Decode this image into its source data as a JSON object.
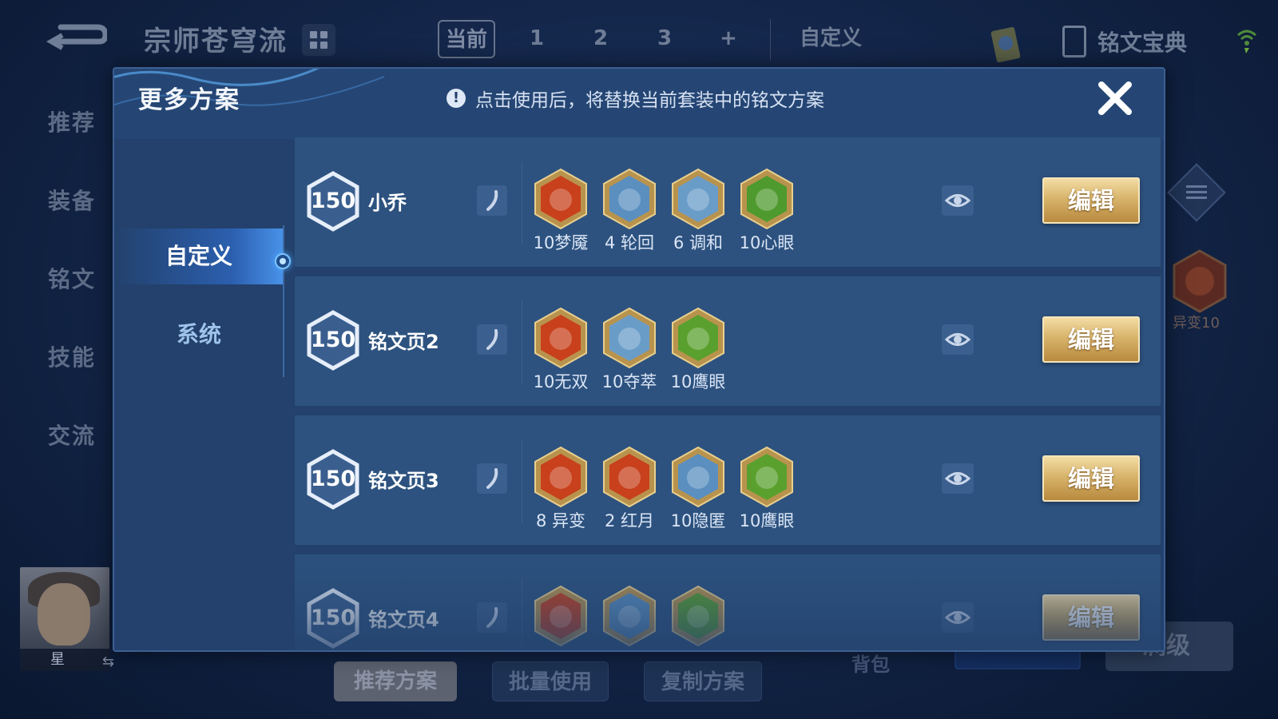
{
  "background": {
    "page_title": "宗师苍穹流",
    "slot_tabs": [
      "当前",
      "1",
      "2",
      "3",
      "+"
    ],
    "custom_label": "自定义",
    "codex_label": "铭文宝典",
    "side_nav": [
      "推荐",
      "装备",
      "铭文",
      "技能",
      "交流"
    ],
    "hero_name": "星",
    "side_mutation_label": "异变10",
    "bottom_buttons": {
      "recommend": "推荐方案",
      "batch": "批量使用",
      "copy": "复制方案"
    },
    "backpack_label": "背包",
    "max_level_label": "满级"
  },
  "modal": {
    "title": "更多方案",
    "notice": "点击使用后，将替换当前套装中的铭文方案",
    "categories": [
      {
        "label": "自定义",
        "active": true
      },
      {
        "label": "系统",
        "active": false
      }
    ],
    "plans": [
      {
        "level": "150",
        "name": "小乔",
        "edit_label": "编辑",
        "runes": [
          {
            "label": "10梦魇",
            "icon": "rune-nightmare-icon",
            "color": "#c8401c"
          },
          {
            "label": "4 轮回",
            "icon": "rune-cycle-icon",
            "color": "#5a8fc0"
          },
          {
            "label": "6 调和",
            "icon": "rune-harmony-icon",
            "color": "#6a9cc8"
          },
          {
            "label": "10心眼",
            "icon": "rune-mind-eye-icon",
            "color": "#4e9a2e"
          }
        ]
      },
      {
        "level": "150",
        "name": "铭文页2",
        "edit_label": "编辑",
        "runes": [
          {
            "label": "10无双",
            "icon": "rune-peerless-icon",
            "color": "#c8401c"
          },
          {
            "label": "10夺萃",
            "icon": "rune-seize-icon",
            "color": "#6a9cc8"
          },
          {
            "label": "10鹰眼",
            "icon": "rune-hawk-eye-icon",
            "color": "#5aa02e"
          }
        ]
      },
      {
        "level": "150",
        "name": "铭文页3",
        "edit_label": "编辑",
        "runes": [
          {
            "label": "8 异变",
            "icon": "rune-mutation-icon",
            "color": "#c8401c"
          },
          {
            "label": "2 红月",
            "icon": "rune-red-moon-icon",
            "color": "#c8401c"
          },
          {
            "label": "10隐匿",
            "icon": "rune-stealth-icon",
            "color": "#5a8fc0"
          },
          {
            "label": "10鹰眼",
            "icon": "rune-hawk-eye-icon",
            "color": "#5aa02e"
          }
        ]
      },
      {
        "level": "150",
        "name": "铭文页4",
        "edit_label": "编辑",
        "runes": [
          {
            "label": "",
            "icon": "rune-mutation-icon",
            "color": "#c8401c"
          },
          {
            "label": "",
            "icon": "rune-stealth-icon",
            "color": "#5a8fc0"
          },
          {
            "label": "",
            "icon": "rune-hawk-eye-icon",
            "color": "#5aa02e"
          }
        ]
      }
    ]
  },
  "colors": {
    "modal_bg": "#23416c",
    "row_bg": "#2d527f",
    "edit_gold": "#d8b46b",
    "red_rune": "#c8401c",
    "blue_rune": "#6a9cc8",
    "green_rune": "#5aa02e"
  }
}
